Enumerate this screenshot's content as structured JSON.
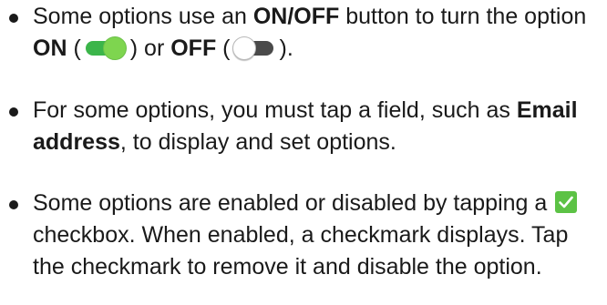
{
  "bullets": [
    {
      "seg1": "Some options use an ",
      "bold1": "ON/OFF",
      "seg2": " button to turn the option ",
      "bold2": "ON",
      "seg3": " (",
      "seg4": ") or ",
      "bold3": "OFF",
      "seg5": " (",
      "seg6": ")."
    },
    {
      "seg1": "For some options, you must tap a field, such as ",
      "bold1": "Email address",
      "seg2": ", to display and set options."
    },
    {
      "seg1": "Some options are enabled or disabled by tapping a ",
      "seg2": " checkbox. When enabled, a checkmark displays. Tap the checkmark to remove it and disable the option."
    }
  ],
  "icons": {
    "toggle_on": "toggle-on-icon",
    "toggle_off": "toggle-off-icon",
    "checkbox": "checkbox-checked-icon"
  },
  "colors": {
    "toggle_on_track": "#3bb54a",
    "toggle_on_knob": "#7ed54f",
    "toggle_off_track": "#4a4a4a",
    "checkbox": "#5cc245"
  }
}
